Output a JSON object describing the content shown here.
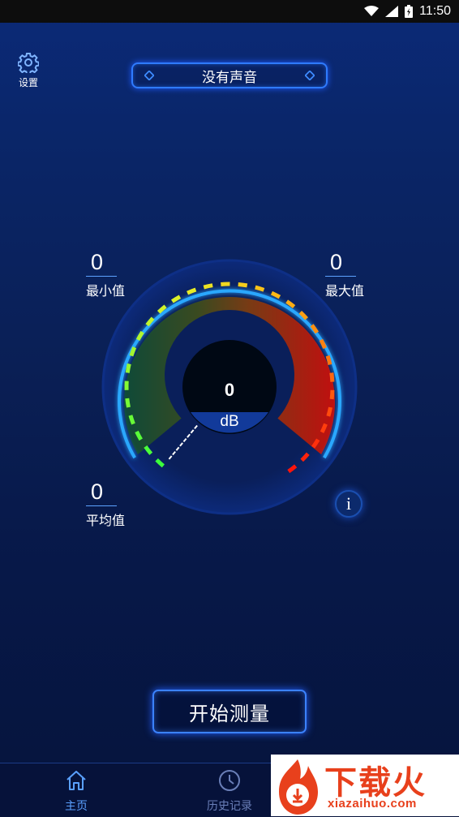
{
  "status_bar": {
    "time": "11:50"
  },
  "settings": {
    "label": "设置"
  },
  "mode": {
    "label": "没有声音"
  },
  "stats": {
    "min": {
      "value": "0",
      "label": "最小值"
    },
    "max": {
      "value": "0",
      "label": "最大值"
    },
    "avg": {
      "value": "0",
      "label": "平均值"
    }
  },
  "gauge": {
    "value": "0",
    "unit": "dB",
    "level": 0
  },
  "info": {
    "label": "i"
  },
  "actions": {
    "start_label": "开始测量"
  },
  "bottom_nav": {
    "items": [
      {
        "label": "主页",
        "icon": "home-icon",
        "active": true
      },
      {
        "label": "历史记录",
        "icon": "clock-icon",
        "active": false
      }
    ]
  },
  "watermark": {
    "title": "下载火",
    "url": "xiazaihuo.com"
  },
  "colors": {
    "accent": "#2f7bff",
    "active_nav": "#5aa0ff",
    "inactive_nav": "#6a7fb8",
    "watermark": "#e8401c"
  }
}
